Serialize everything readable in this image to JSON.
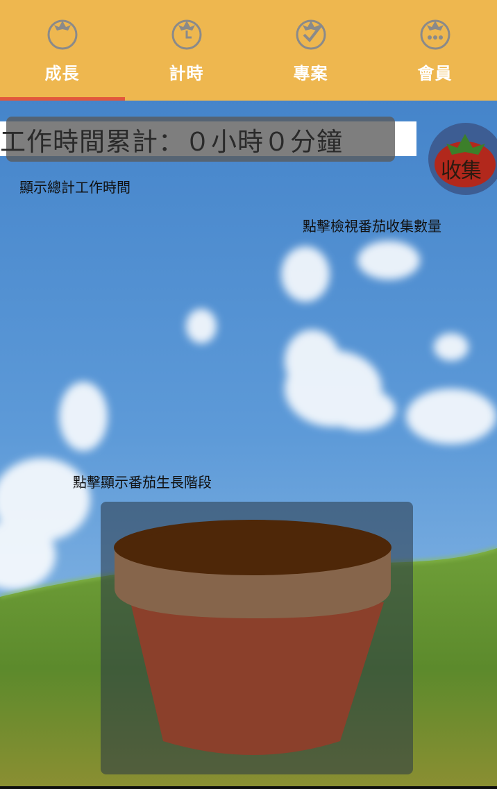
{
  "tabs": [
    {
      "label": "成長",
      "icon": "tomato-icon",
      "active": true
    },
    {
      "label": "計時",
      "icon": "timer-tomato-icon",
      "active": false
    },
    {
      "label": "專案",
      "icon": "check-tomato-icon",
      "active": false
    },
    {
      "label": "會員",
      "icon": "member-tomato-icon",
      "active": false
    }
  ],
  "work_time": {
    "text": "工作時間累計：０小時０分鐘",
    "hint": "顯示總計工作時間"
  },
  "collect": {
    "label": "收集",
    "hint": "點擊檢視番茄收集數量"
  },
  "pot": {
    "hint": "點擊顯示番茄生長階段"
  },
  "colors": {
    "tabbar": "#eeb74f",
    "active_indicator": "#e2573c",
    "sky": "#3f7fc7",
    "grass": "#5f8f2e",
    "pot_body": "#8b402b",
    "pot_rim": "#86654b",
    "soil": "#4e2708"
  }
}
